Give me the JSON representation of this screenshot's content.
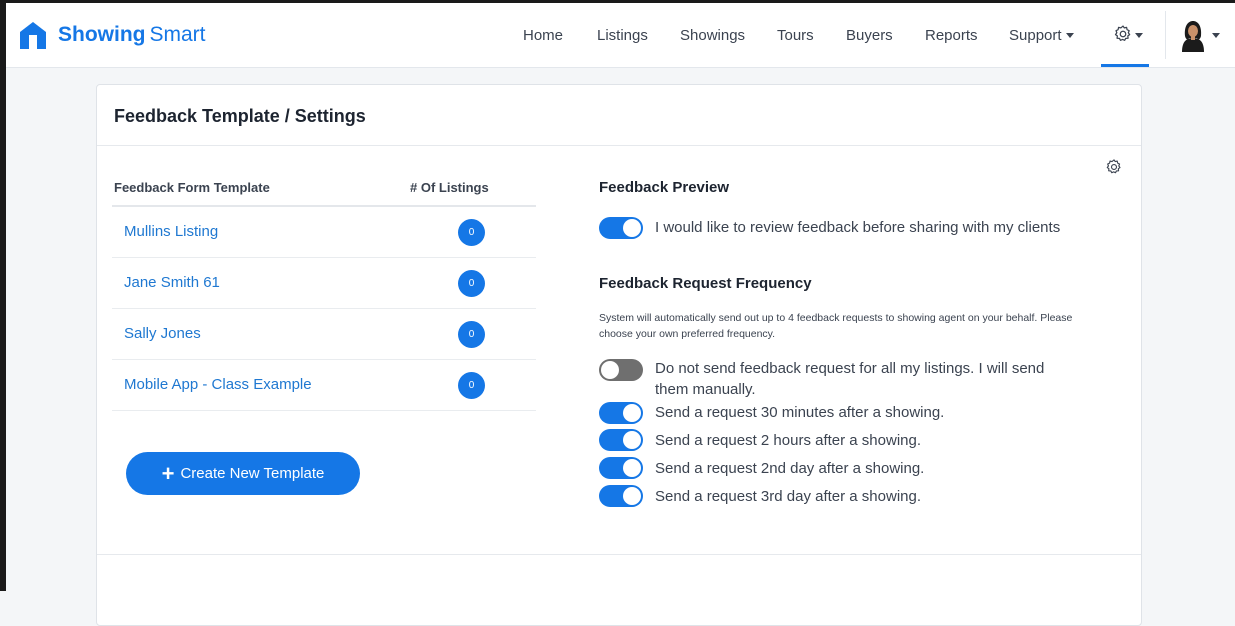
{
  "brand": {
    "name_bold": "Showing",
    "name_light": "Smart",
    "color": "#1577e6"
  },
  "nav": {
    "items": [
      {
        "label": "Home"
      },
      {
        "label": "Listings"
      },
      {
        "label": "Showings"
      },
      {
        "label": "Tours"
      },
      {
        "label": "Buyers"
      },
      {
        "label": "Reports"
      }
    ],
    "support_label": "Support",
    "settings_icon": "gear-icon",
    "active": "settings"
  },
  "page": {
    "title": "Feedback Template / Settings"
  },
  "templates_table": {
    "headers": {
      "template": "Feedback Form Template",
      "count": "# Of Listings"
    },
    "rows": [
      {
        "name": "Mullins Listing",
        "count": "0"
      },
      {
        "name": "Jane Smith 61",
        "count": "0"
      },
      {
        "name": "Sally Jones",
        "count": "0"
      },
      {
        "name": "Mobile App - Class Example",
        "count": "0"
      }
    ]
  },
  "create_button": {
    "label": "Create New Template",
    "icon": "plus-icon"
  },
  "preview": {
    "title": "Feedback Preview",
    "toggle_label": "I would like to review feedback before sharing with my clients",
    "enabled": true
  },
  "frequency": {
    "title": "Feedback Request Frequency",
    "help_text": "System will automatically send out up to 4 feedback requests to showing agent on your behalf. Please choose your own preferred frequency.",
    "options": [
      {
        "label_line1": "Do not send feedback request for all my listings. I will send",
        "label_line2": "them manually.",
        "enabled": false
      },
      {
        "label": "Send a request 30 minutes after a showing.",
        "enabled": true
      },
      {
        "label": "Send a request 2 hours after a showing.",
        "enabled": true
      },
      {
        "label": "Send a request 2nd day after a showing.",
        "enabled": true
      },
      {
        "label": "Send a request 3rd day after a showing.",
        "enabled": true
      }
    ]
  },
  "colors": {
    "accent": "#1577e6",
    "toggle_off": "#6f6f6f",
    "link": "#1f78d1"
  }
}
